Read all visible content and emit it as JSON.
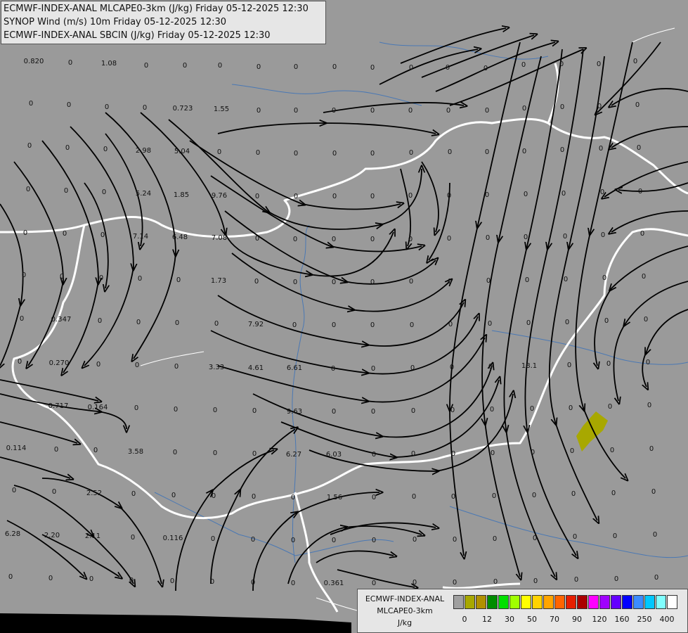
{
  "header": {
    "line1": "ECMWF-INDEX-ANAL MLCAPE0-3km (J/kg) Friday 05-12-2025 12:30",
    "line2": "SYNOP Wind (m/s) 10m Friday 05-12-2025 12:30",
    "line3": "ECMWF-INDEX-ANAL SBCIN (J/kg) Friday 05-12-2025 12:30"
  },
  "legend": {
    "title1": "ECMWF-INDEX-ANAL",
    "title2": "MLCAPE0-3km",
    "title3": "J/kg",
    "colors": [
      "#a0a0a0",
      "#a8a800",
      "#b09000",
      "#008c00",
      "#00e000",
      "#a0ff00",
      "#ffff00",
      "#ffd200",
      "#ffa500",
      "#ff6400",
      "#e61e00",
      "#aa0000",
      "#ff00ff",
      "#a000ff",
      "#6400ff",
      "#0000ff",
      "#3c8cff",
      "#00c8ff",
      "#80ffff",
      "#ffffff"
    ],
    "ticks": [
      "0",
      "12",
      "30",
      "50",
      "70",
      "90",
      "120",
      "160",
      "250",
      "400"
    ]
  },
  "colors": {
    "background": "#9a9a9a",
    "border": "#ffffff",
    "streamline": "#000000",
    "river": "#4a78b4",
    "cape_patch": "#a8a800"
  },
  "values": [
    [
      "0.820",
      48,
      90
    ],
    [
      "0",
      100,
      92
    ],
    [
      "1.08",
      155,
      93
    ],
    [
      "0",
      208,
      96
    ],
    [
      "0",
      263,
      96
    ],
    [
      "0",
      313,
      96
    ],
    [
      "0",
      368,
      98
    ],
    [
      "0",
      421,
      98
    ],
    [
      "0",
      476,
      98
    ],
    [
      "0",
      530,
      99
    ],
    [
      "0",
      585,
      99
    ],
    [
      "0",
      637,
      99
    ],
    [
      "0",
      691,
      100
    ],
    [
      "0",
      745,
      95
    ],
    [
      "0",
      799,
      94
    ],
    [
      "0",
      852,
      94
    ],
    [
      "0",
      904,
      90
    ],
    [
      "0",
      44,
      150
    ],
    [
      "0",
      98,
      152
    ],
    [
      "0",
      152,
      155
    ],
    [
      "0",
      206,
      156
    ],
    [
      "0.723",
      260,
      157
    ],
    [
      "1.55",
      315,
      158
    ],
    [
      "0",
      368,
      160
    ],
    [
      "0",
      421,
      160
    ],
    [
      "0",
      475,
      160
    ],
    [
      "0",
      530,
      160
    ],
    [
      "0",
      584,
      160
    ],
    [
      "0",
      638,
      160
    ],
    [
      "0",
      693,
      160
    ],
    [
      "0",
      746,
      157
    ],
    [
      "0",
      800,
      155
    ],
    [
      "0",
      853,
      154
    ],
    [
      "0",
      907,
      152
    ],
    [
      "0",
      42,
      210
    ],
    [
      "0",
      96,
      213
    ],
    [
      "0",
      150,
      215
    ],
    [
      "2.98",
      204,
      217
    ],
    [
      "5.04",
      259,
      218
    ],
    [
      "0",
      312,
      219
    ],
    [
      "0",
      367,
      220
    ],
    [
      "0",
      421,
      221
    ],
    [
      "0",
      476,
      221
    ],
    [
      "0",
      530,
      221
    ],
    [
      "0",
      585,
      220
    ],
    [
      "0",
      640,
      219
    ],
    [
      "0",
      693,
      219
    ],
    [
      "0",
      746,
      218
    ],
    [
      "0",
      800,
      216
    ],
    [
      "0",
      855,
      214
    ],
    [
      "0",
      909,
      213
    ],
    [
      "0",
      40,
      272
    ],
    [
      "0",
      94,
      274
    ],
    [
      "0",
      148,
      276
    ],
    [
      "5.24",
      204,
      278
    ],
    [
      "1.85",
      258,
      280
    ],
    [
      "9.76",
      312,
      281
    ],
    [
      "0",
      366,
      282
    ],
    [
      "0",
      421,
      282
    ],
    [
      "0",
      476,
      282
    ],
    [
      "0",
      530,
      282
    ],
    [
      "0",
      584,
      281
    ],
    [
      "0",
      639,
      281
    ],
    [
      "0",
      693,
      280
    ],
    [
      "0",
      748,
      279
    ],
    [
      "0",
      802,
      278
    ],
    [
      "0",
      857,
      276
    ],
    [
      "0",
      911,
      275
    ],
    [
      "0",
      36,
      334
    ],
    [
      "0",
      92,
      335
    ],
    [
      "0",
      146,
      337
    ],
    [
      "7.14",
      200,
      339
    ],
    [
      "6.48",
      256,
      340
    ],
    [
      "7.08",
      312,
      341
    ],
    [
      "0",
      366,
      342
    ],
    [
      "0",
      420,
      343
    ],
    [
      "0",
      475,
      343
    ],
    [
      "0",
      530,
      343
    ],
    [
      "0",
      584,
      343
    ],
    [
      "0",
      639,
      342
    ],
    [
      "0",
      694,
      341
    ],
    [
      "0",
      748,
      340
    ],
    [
      "0",
      804,
      339
    ],
    [
      "0",
      858,
      337
    ],
    [
      "0",
      914,
      335
    ],
    [
      "0",
      34,
      394
    ],
    [
      "0",
      88,
      396
    ],
    [
      "0",
      144,
      398
    ],
    [
      "0",
      199,
      399
    ],
    [
      "0",
      254,
      401
    ],
    [
      "1.73",
      311,
      402
    ],
    [
      "0",
      365,
      403
    ],
    [
      "0",
      420,
      404
    ],
    [
      "0",
      475,
      404
    ],
    [
      "0",
      530,
      404
    ],
    [
      "0",
      585,
      403
    ],
    [
      "0",
      640,
      403
    ],
    [
      "0",
      695,
      402
    ],
    [
      "0",
      750,
      401
    ],
    [
      "0",
      805,
      400
    ],
    [
      "0",
      860,
      398
    ],
    [
      "0",
      916,
      396
    ],
    [
      "0",
      31,
      456
    ],
    [
      "0.347",
      87,
      457
    ],
    [
      "0",
      142,
      459
    ],
    [
      "0",
      197,
      461
    ],
    [
      "0",
      252,
      462
    ],
    [
      "0",
      308,
      463
    ],
    [
      "7.92",
      364,
      464
    ],
    [
      "0",
      419,
      465
    ],
    [
      "0",
      475,
      465
    ],
    [
      "0",
      530,
      465
    ],
    [
      "0",
      586,
      465
    ],
    [
      "0",
      641,
      464
    ],
    [
      "0",
      697,
      463
    ],
    [
      "0",
      752,
      462
    ],
    [
      "0",
      807,
      461
    ],
    [
      "0",
      863,
      459
    ],
    [
      "0",
      919,
      457
    ],
    [
      "0",
      28,
      517
    ],
    [
      "0.270",
      84,
      519
    ],
    [
      "0",
      140,
      521
    ],
    [
      "0",
      195,
      522
    ],
    [
      "0",
      251,
      524
    ],
    [
      "3.33",
      308,
      525
    ],
    [
      "4.61",
      364,
      526
    ],
    [
      "6.61",
      419,
      526
    ],
    [
      "0",
      474,
      527
    ],
    [
      "0",
      531,
      527
    ],
    [
      "0",
      587,
      526
    ],
    [
      "0",
      643,
      525
    ],
    [
      "0",
      698,
      524
    ],
    [
      "18.1",
      753,
      523
    ],
    [
      "0",
      810,
      522
    ],
    [
      "0",
      866,
      520
    ],
    [
      "0",
      922,
      518
    ],
    [
      "0.717",
      83,
      580
    ],
    [
      "0.164",
      139,
      582
    ],
    [
      "0",
      194,
      583
    ],
    [
      "0",
      250,
      585
    ],
    [
      "0",
      306,
      586
    ],
    [
      "0",
      362,
      587
    ],
    [
      "9.63",
      419,
      588
    ],
    [
      "0",
      475,
      588
    ],
    [
      "0",
      531,
      588
    ],
    [
      "0",
      588,
      587
    ],
    [
      "0",
      644,
      586
    ],
    [
      "0",
      700,
      585
    ],
    [
      "0",
      757,
      584
    ],
    [
      "0",
      812,
      583
    ],
    [
      "0",
      868,
      581
    ],
    [
      "0",
      924,
      579
    ],
    [
      "0.114",
      23,
      640
    ],
    [
      "0",
      80,
      642
    ],
    [
      "0",
      136,
      643
    ],
    [
      "3.58",
      193,
      645
    ],
    [
      "0",
      249,
      646
    ],
    [
      "0",
      306,
      647
    ],
    [
      "0",
      362,
      648
    ],
    [
      "6.27",
      418,
      649
    ],
    [
      "6.03",
      475,
      649
    ],
    [
      "0",
      532,
      649
    ],
    [
      "0",
      588,
      648
    ],
    [
      "0",
      645,
      648
    ],
    [
      "0",
      701,
      647
    ],
    [
      "0",
      758,
      646
    ],
    [
      "0",
      814,
      644
    ],
    [
      "0",
      871,
      643
    ],
    [
      "0",
      927,
      641
    ],
    [
      "0",
      20,
      700
    ],
    [
      "0",
      77,
      702
    ],
    [
      "2.52",
      134,
      704
    ],
    [
      "0",
      190,
      705
    ],
    [
      "0",
      247,
      707
    ],
    [
      "0",
      304,
      708
    ],
    [
      "0",
      361,
      709
    ],
    [
      "0",
      417,
      710
    ],
    [
      "1.56",
      476,
      710
    ],
    [
      "0",
      532,
      710
    ],
    [
      "0",
      589,
      709
    ],
    [
      "0",
      645,
      709
    ],
    [
      "0",
      703,
      708
    ],
    [
      "0",
      760,
      707
    ],
    [
      "0",
      816,
      705
    ],
    [
      "0",
      873,
      704
    ],
    [
      "0",
      930,
      702
    ],
    [
      "6.28",
      18,
      762
    ],
    [
      "2.20",
      74,
      764
    ],
    [
      "2.11",
      132,
      765
    ],
    [
      "0",
      189,
      767
    ],
    [
      "0.116",
      246,
      768
    ],
    [
      "0",
      303,
      769
    ],
    [
      "0",
      360,
      770
    ],
    [
      "0",
      417,
      771
    ],
    [
      "0",
      475,
      771
    ],
    [
      "0",
      532,
      771
    ],
    [
      "0",
      590,
      770
    ],
    [
      "0",
      647,
      770
    ],
    [
      "0",
      704,
      769
    ],
    [
      "0",
      761,
      768
    ],
    [
      "0",
      818,
      766
    ],
    [
      "0",
      875,
      765
    ],
    [
      "0",
      932,
      763
    ],
    [
      "0",
      15,
      823
    ],
    [
      "0",
      72,
      825
    ],
    [
      "0",
      130,
      826
    ],
    [
      "0",
      187,
      828
    ],
    [
      "0",
      245,
      829
    ],
    [
      "0",
      302,
      830
    ],
    [
      "0",
      360,
      831
    ],
    [
      "0",
      417,
      832
    ],
    [
      "0.361",
      475,
      832
    ],
    [
      "0",
      532,
      832
    ],
    [
      "0",
      590,
      831
    ],
    [
      "0",
      647,
      831
    ],
    [
      "0",
      705,
      830
    ],
    [
      "0",
      762,
      829
    ],
    [
      "0",
      820,
      827
    ],
    [
      "0",
      877,
      826
    ],
    [
      "0",
      934,
      824
    ]
  ]
}
